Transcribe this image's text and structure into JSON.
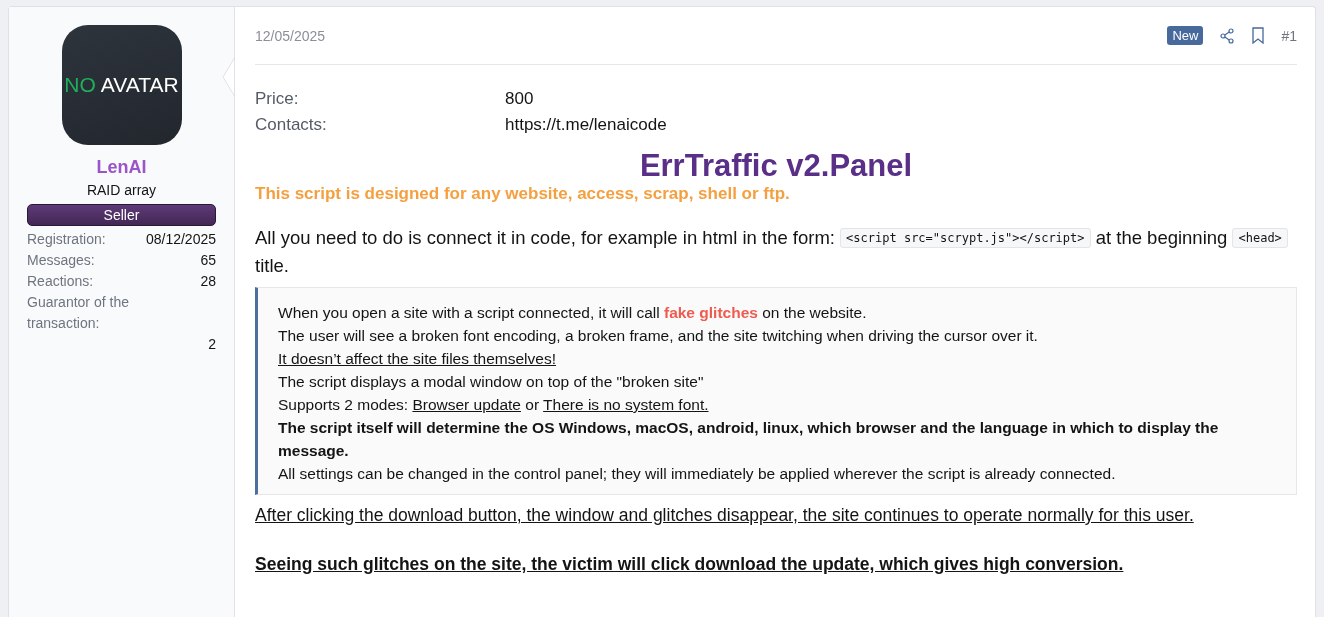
{
  "author": {
    "avatar": {
      "first": "NO",
      "second": "AVATAR"
    },
    "name": "LenAI",
    "title": "RAID array",
    "badge": "Seller",
    "stats": [
      {
        "label": "Registration:",
        "value": "08/12/2025"
      },
      {
        "label": "Messages:",
        "value": "65"
      },
      {
        "label": "Reactions:",
        "value": "28"
      },
      {
        "label": "Guarantor of the transaction:",
        "value": "2"
      }
    ]
  },
  "post": {
    "date": "12/05/2025",
    "new_label": "New",
    "number": "#1",
    "fields": [
      {
        "label": "Price:",
        "value": "800"
      },
      {
        "label": "Contacts:",
        "value": "https://t.me/lenaicode"
      }
    ],
    "heading": "ErrTraffic v2.Panel",
    "subheading": "This script is designed for any website, access, scrap, shell or ftp.",
    "intro": [
      {
        "kind": "text",
        "text": "All you need to do is connect it in code, for example in html in the form: "
      },
      {
        "kind": "code",
        "text": "<script src=\"scrypt.js\"></script>"
      },
      {
        "kind": "text",
        "text": " at the beginning "
      },
      {
        "kind": "code",
        "text": "<head>"
      },
      {
        "kind": "text",
        "text": " title."
      }
    ],
    "quote": [
      {
        "kind": "plain",
        "parts": [
          {
            "kind": "text",
            "text": "When you open a site with a script connected, it will call "
          },
          {
            "kind": "highlight",
            "text": "fake glitches"
          },
          {
            "kind": "text",
            "text": " on the website."
          }
        ]
      },
      {
        "kind": "plain",
        "parts": [
          {
            "kind": "text",
            "text": "The user will see a broken font encoding, a broken frame, and the site twitching when driving the cursor over it."
          }
        ]
      },
      {
        "kind": "plain",
        "parts": [
          {
            "kind": "underline",
            "text": "It doesn’t affect the site files themselves!"
          }
        ]
      },
      {
        "kind": "plain",
        "parts": [
          {
            "kind": "text",
            "text": "The script displays a modal window on top of the \"broken site\""
          }
        ]
      },
      {
        "kind": "plain",
        "parts": [
          {
            "kind": "text",
            "text": "Supports 2 modes: "
          },
          {
            "kind": "underline",
            "text": "Browser update"
          },
          {
            "kind": "text",
            "text": " or "
          },
          {
            "kind": "underline",
            "text": "There is no system font."
          }
        ]
      },
      {
        "kind": "bold",
        "parts": [
          {
            "kind": "text",
            "text": "The script itself will determine the OS Windows, macOS, android, linux, which browser and the language in which to display the message."
          }
        ]
      },
      {
        "kind": "plain",
        "parts": [
          {
            "kind": "text",
            "text": "All settings can be changed in the control panel; they will immediately be applied wherever the script is already connected."
          }
        ]
      }
    ],
    "closing": [
      {
        "kind": "underline",
        "text": "After clicking the download button, the window and glitches disappear, the site continues to operate normally for this user."
      },
      {
        "kind": "bold-underline",
        "text": "Seeing such glitches on the site, the victim will click download the update, which gives high conversion."
      }
    ]
  }
}
